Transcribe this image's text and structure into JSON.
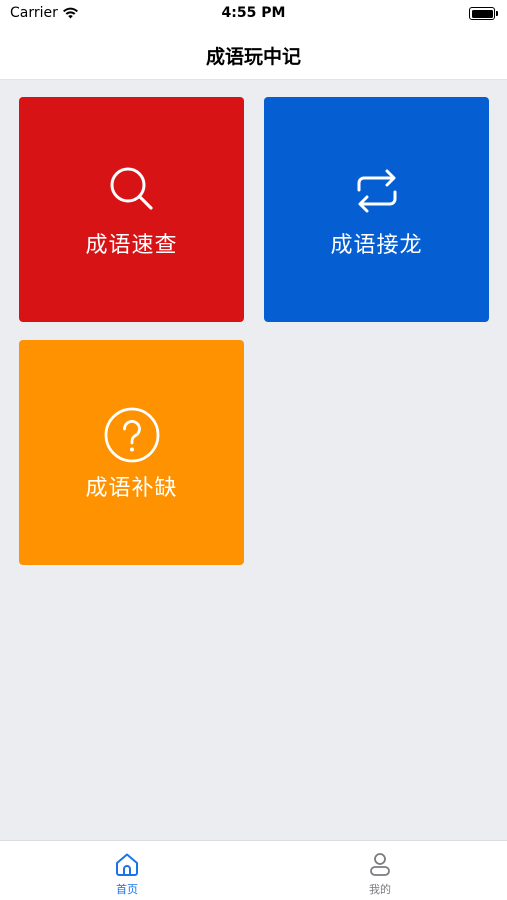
{
  "status_bar": {
    "carrier": "Carrier",
    "time": "4:55 PM",
    "wifi_icon": "wifi-icon",
    "battery_icon": "battery-icon"
  },
  "nav": {
    "title": "成语玩中记"
  },
  "tiles": [
    {
      "label": "成语速查",
      "icon": "search-icon",
      "color": "#d71316"
    },
    {
      "label": "成语接龙",
      "icon": "repeat-icon",
      "color": "#055fd2"
    },
    {
      "label": "成语补缺",
      "icon": "question-circle-icon",
      "color": "#fe9200"
    }
  ],
  "tabbar": {
    "tabs": [
      {
        "label": "首页",
        "icon": "home-icon",
        "active": true,
        "color": "#1a73e8"
      },
      {
        "label": "我的",
        "icon": "person-icon",
        "active": false,
        "color": "#7b7b80"
      }
    ]
  }
}
